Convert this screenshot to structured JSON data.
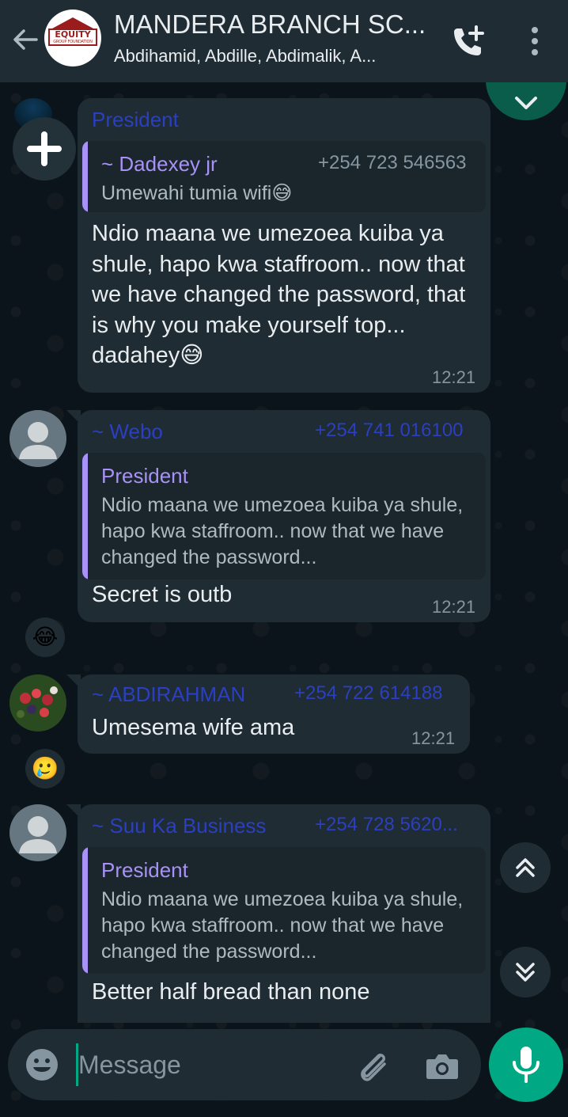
{
  "header": {
    "title": "MANDERA BRANCH SC...",
    "subtitle": "Abdihamid, Abdille, Abdimalik, A...",
    "avatar_logo_text": "EQUITY",
    "avatar_logo_sub": "GROUP FOUNDATION",
    "icons": [
      "back-arrow-icon",
      "add-call-icon",
      "more-vert-icon"
    ]
  },
  "messages": [
    {
      "sender": "President",
      "quote": {
        "name": "~ Dadexey jr",
        "phone": "+254 723 546563",
        "text": "Umewahi tumia wifi😅"
      },
      "text": "Ndio maana we umezoea kuiba ya shule, hapo kwa staffroom.. now that we have changed the password, that is why you make yourself top... dadahey😅",
      "time": "12:21"
    },
    {
      "sender": "~ Webo",
      "phone": "+254 741 016100",
      "quote": {
        "name": "President",
        "text": "Ndio maana we umezoea kuiba ya shule, hapo kwa staffroom.. now that we have changed the password..."
      },
      "text": "Secret is outb",
      "time": "12:21",
      "reaction": "😂"
    },
    {
      "sender": "~ ABDIRAHMAN",
      "phone": "+254 722 614188",
      "text": "Umesema wife ama",
      "time": "12:21",
      "reaction": "🥲"
    },
    {
      "sender": "~ Suu Ka Business",
      "phone": "+254 728 5620...",
      "quote": {
        "name": "President",
        "text": "Ndio maana we umezoea kuiba ya shule, hapo kwa staffroom.. now that we have changed the password..."
      },
      "text": "Better half bread than none"
    }
  ],
  "composer": {
    "placeholder": "Message"
  },
  "colors": {
    "accent": "#00a884",
    "bubble": "#1f2c34",
    "header": "#1f2c34",
    "quote_name": "#a891f7",
    "sender_name": "#2b3fc1"
  }
}
